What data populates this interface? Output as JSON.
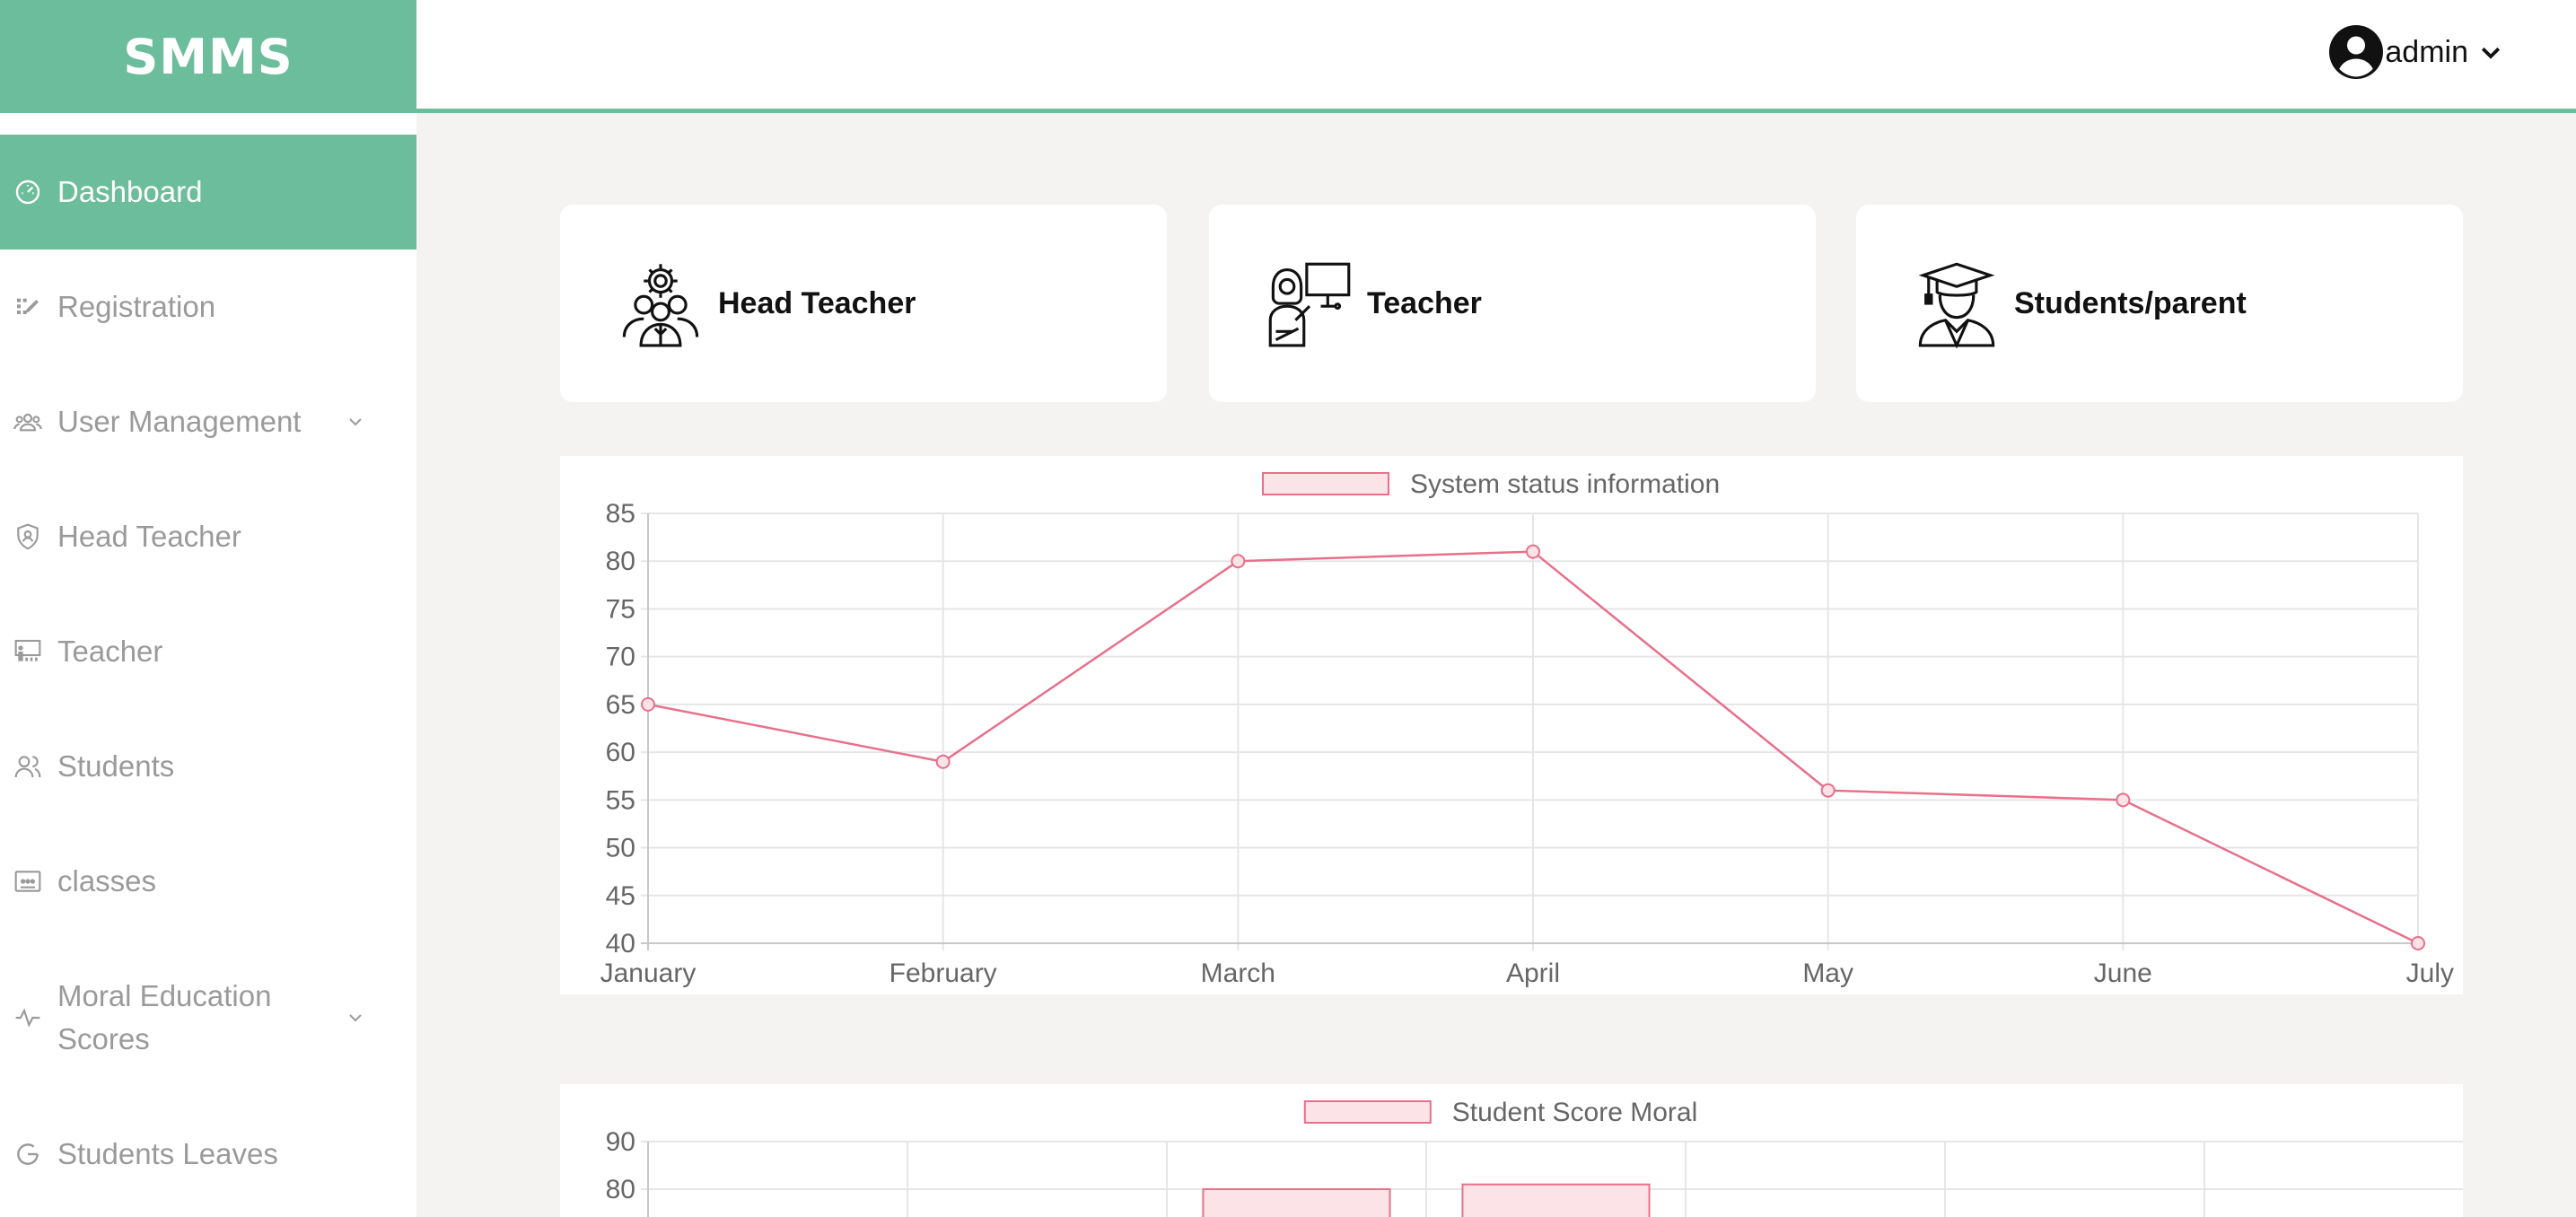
{
  "app": {
    "brand": "SMMS"
  },
  "user": {
    "name": "admin"
  },
  "sidebar": {
    "items": [
      {
        "label": "Dashboard",
        "icon": "dashboard-icon"
      },
      {
        "label": "Registration",
        "icon": "registration-icon"
      },
      {
        "label": "User Management",
        "icon": "users-icon"
      },
      {
        "label": "Head Teacher",
        "icon": "shield-user-icon"
      },
      {
        "label": "Teacher",
        "icon": "teacher-board-icon"
      },
      {
        "label": "Students",
        "icon": "students-icon"
      },
      {
        "label": "classes",
        "icon": "classes-icon"
      },
      {
        "label": "Moral Education Scores",
        "icon": "activity-icon"
      },
      {
        "label": "Students Leaves",
        "icon": "leave-icon"
      }
    ]
  },
  "cards": [
    {
      "label": "Head Teacher",
      "icon": "head-teacher-icon"
    },
    {
      "label": "Teacher",
      "icon": "teacher-icon"
    },
    {
      "label": "Students/parent",
      "icon": "graduate-icon"
    }
  ],
  "colors": {
    "accent": "#6cbd9b",
    "line": "#e8708a",
    "fill": "#fbe3e8"
  },
  "chart_data": [
    {
      "type": "line",
      "legend": "System status information",
      "legend_position": "top",
      "categories": [
        "January",
        "February",
        "March",
        "April",
        "May",
        "June",
        "July"
      ],
      "values": [
        65,
        59,
        80,
        81,
        56,
        55,
        40
      ],
      "ylim": [
        40,
        85
      ],
      "yticks": [
        85,
        80,
        75,
        70,
        65,
        60,
        55,
        50,
        45,
        40
      ],
      "grid": true
    },
    {
      "type": "bar",
      "legend": "Student Score Moral",
      "legend_position": "top",
      "yticks_visible": [
        90,
        80
      ],
      "partially_visible": true,
      "visible_bars": [
        {
          "slot": 3,
          "value": 80
        },
        {
          "slot": 4,
          "value": 81
        }
      ],
      "grid": true
    }
  ]
}
